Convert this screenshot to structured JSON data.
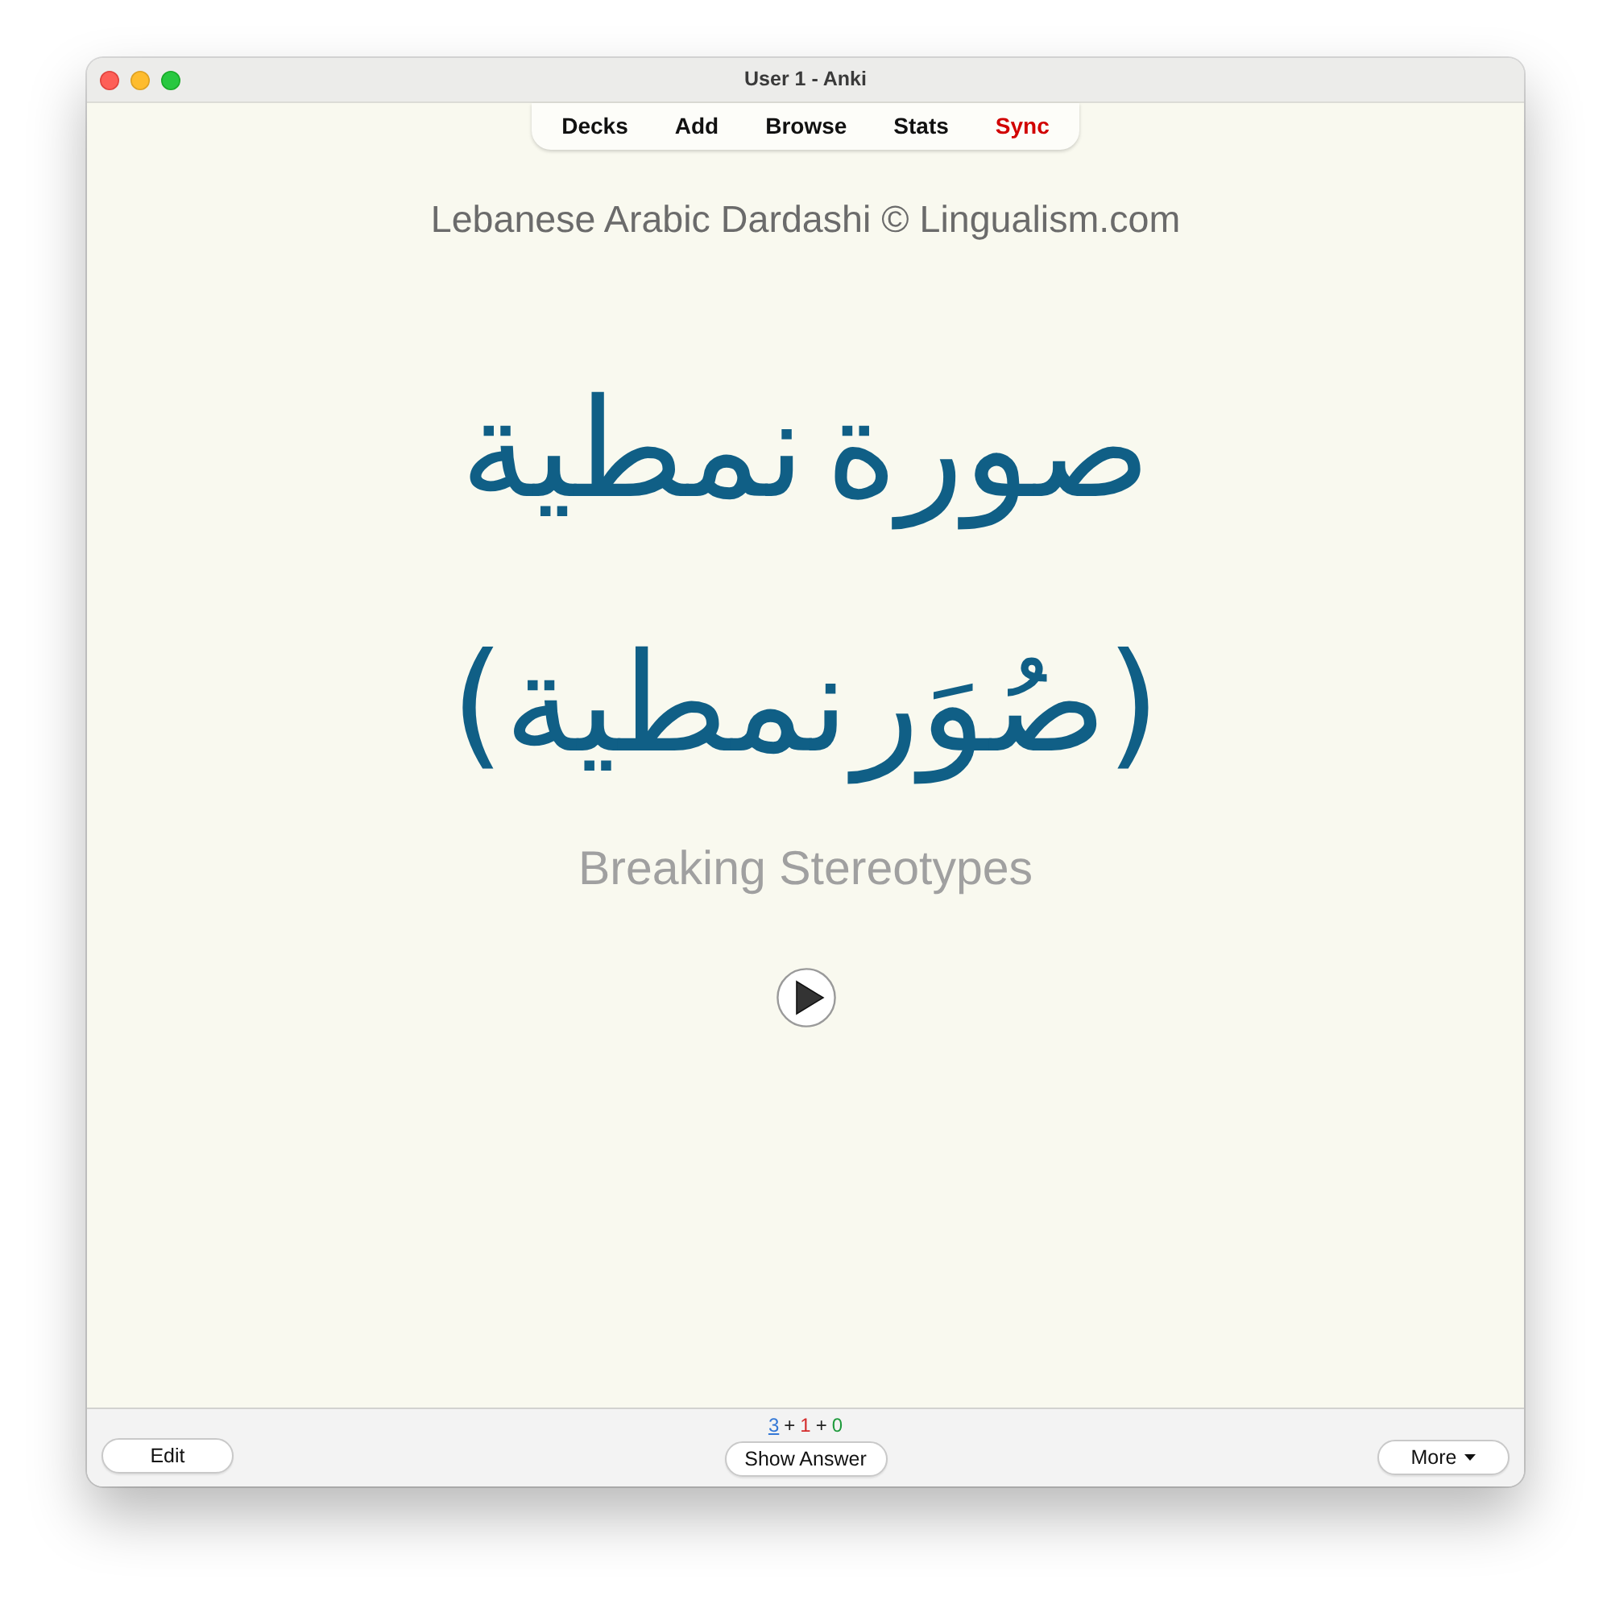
{
  "window": {
    "title": "User 1 - Anki"
  },
  "toolbar": [
    {
      "label": "Decks",
      "alert": false
    },
    {
      "label": "Add",
      "alert": false
    },
    {
      "label": "Browse",
      "alert": false
    },
    {
      "label": "Stats",
      "alert": false
    },
    {
      "label": "Sync",
      "alert": true
    }
  ],
  "card": {
    "heading": "Lebanese Arabic Dardashi © Lingualism.com",
    "lines": [
      "صورة نمطية",
      "(صُوَر نمطية)"
    ],
    "subtitle": "Breaking Stereotypes"
  },
  "bottom_bar": {
    "edit_button": "Edit",
    "counts": [
      {
        "value": "3",
        "color": "#3478d6",
        "current": true
      },
      {
        "value": "1",
        "color": "#d42a2a",
        "current": false
      },
      {
        "value": "0",
        "color": "#1e9a3c",
        "current": false
      }
    ],
    "separators": [
      "+",
      "+"
    ],
    "answer_button": "Show Answer",
    "more_button": "More"
  }
}
